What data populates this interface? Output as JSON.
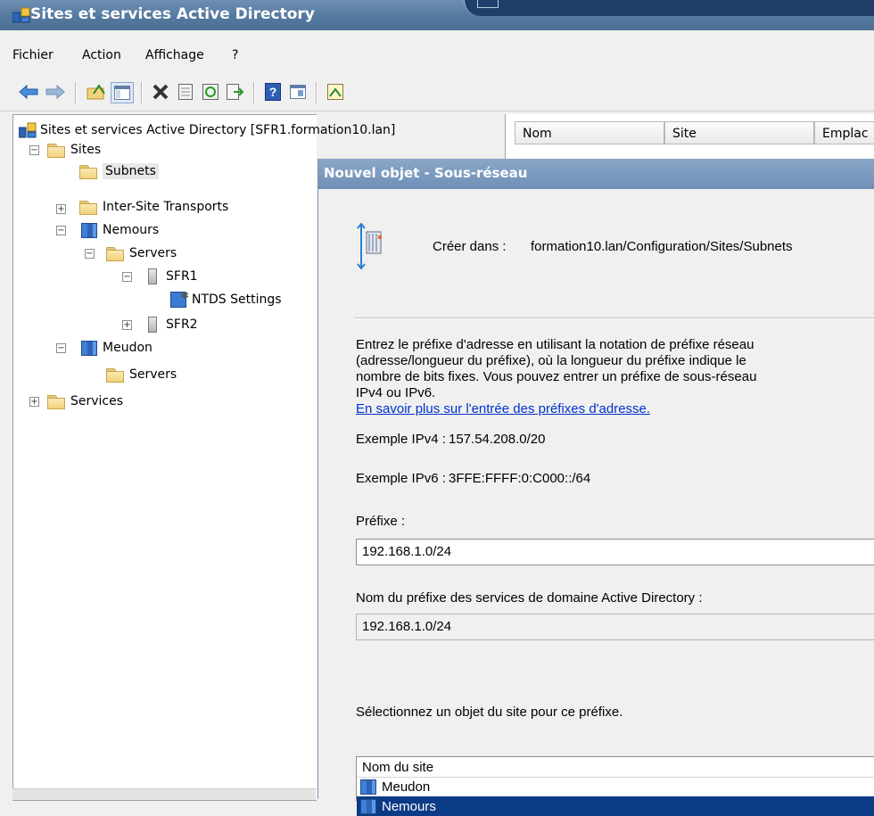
{
  "window": {
    "title": "Sites et services Active Directory"
  },
  "menu": [
    "Fichier",
    "Action",
    "Affichage",
    "?"
  ],
  "toolbar_icons": [
    "back-arrow-icon",
    "forward-arrow-icon",
    "up-folder-icon",
    "show-tree-icon",
    "delete-icon",
    "properties-icon",
    "refresh-icon",
    "export-list-icon",
    "help-icon",
    "mmc-view-icon",
    "filter-icon"
  ],
  "tree": {
    "root": "Sites et services Active Directory [SFR1.formation10.lan]",
    "sites": "Sites",
    "subnets": "Subnets",
    "inter_site": "Inter-Site Transports",
    "nemours": "Nemours",
    "nemours_servers": "Servers",
    "sfr1": "SFR1",
    "ntds": "NTDS Settings",
    "sfr2": "SFR2",
    "meudon": "Meudon",
    "meudon_servers": "Servers",
    "services": "Services"
  },
  "list": {
    "columns": [
      "Nom",
      "Site",
      "Emplac"
    ]
  },
  "dialog": {
    "title": "Nouvel objet - Sous-réseau",
    "create_in_label": "Créer dans :",
    "create_in_path": "formation10.lan/Configuration/Sites/Subnets",
    "description": [
      "Entrez le préfixe d'adresse en utilisant la notation de préfixe réseau",
      "(adresse/longueur du préfixe), où la longueur du préfixe indique le",
      "nombre de bits fixes. Vous pouvez entrer un préfixe de sous-réseau",
      "IPv4 ou IPv6."
    ],
    "help_link": "En savoir plus sur l'entrée des préfixes d'adresse.",
    "example_ipv4_label": "Exemple IPv4 :",
    "example_ipv4": "157.54.208.0/20",
    "example_ipv6_label": "Exemple IPv6 :",
    "example_ipv6": "3FFE:FFFF:0:C000::/64",
    "prefix_label": "Préfixe :",
    "prefix_value": "192.168.1.0/24",
    "ad_name_label": "Nom du préfixe des services de domaine Active Directory :",
    "ad_name_value": "192.168.1.0/24",
    "site_select_label": "Sélectionnez un objet du site pour ce préfixe.",
    "site_column": "Nom du site",
    "sites": [
      "Meudon",
      "Nemours"
    ],
    "selected_site": "Nemours"
  },
  "colors": {
    "titlebar": "#55799f",
    "selection": "#0b3a86",
    "link": "#0033cc"
  }
}
